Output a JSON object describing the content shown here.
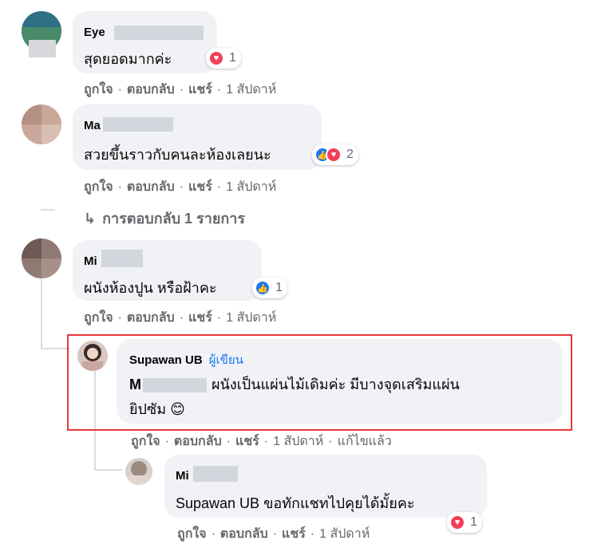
{
  "comments": [
    {
      "name": "Eye",
      "text": "สุดยอดมากค่ะ",
      "reaction": {
        "icons": [
          "love-icon"
        ],
        "count": "1"
      },
      "actions": {
        "like": "ถูกใจ",
        "reply": "ตอบกลับ",
        "share": "แชร์",
        "time": "1 สัปดาห์"
      }
    },
    {
      "name": "Ma",
      "text": "สวยขึ้นราวกับคนละห้องเลยนะ",
      "reaction": {
        "icons": [
          "like-icon",
          "love-icon"
        ],
        "count": "2"
      },
      "actions": {
        "like": "ถูกใจ",
        "reply": "ตอบกลับ",
        "share": "แชร์",
        "time": "1 สัปดาห์"
      },
      "replies_link": "การตอบกลับ 1 รายการ"
    },
    {
      "name": "Mi",
      "text": "ผนังห้องปูน หรือฝ้าคะ",
      "reaction": {
        "icons": [
          "like-icon"
        ],
        "count": "1"
      },
      "actions": {
        "like": "ถูกใจ",
        "reply": "ตอบกลับ",
        "share": "แชร์",
        "time": "1 สัปดาห์"
      }
    }
  ],
  "reply_author": {
    "name": "Supawan UB",
    "badge": "ผู้เขียน",
    "mention": "M",
    "text_line1": "ผนังเป็นแผ่นไม้เดิมค่ะ มีบางจุดเสริมแผ่น",
    "text_line2": "ยิปซัม",
    "emoji": "😊",
    "actions": {
      "like": "ถูกใจ",
      "reply": "ตอบกลับ",
      "share": "แชร์",
      "time": "1 สัปดาห์",
      "edited": "แก้ไขแล้ว"
    }
  },
  "reply_user": {
    "name": "Mi",
    "text": "Supawan UB ขอทักแชทไปคุยได้มั้ยคะ",
    "reaction": {
      "icons": [
        "love-icon"
      ],
      "count": "1"
    },
    "actions": {
      "like": "ถูกใจ",
      "reply": "ตอบกลับ",
      "share": "แชร์",
      "time": "1 สัปดาห์"
    }
  },
  "separator": "·",
  "colors": {
    "highlight": "#e53935",
    "like": "#1877f2",
    "love": "#f33e58",
    "bubble": "#f0f2f5"
  }
}
